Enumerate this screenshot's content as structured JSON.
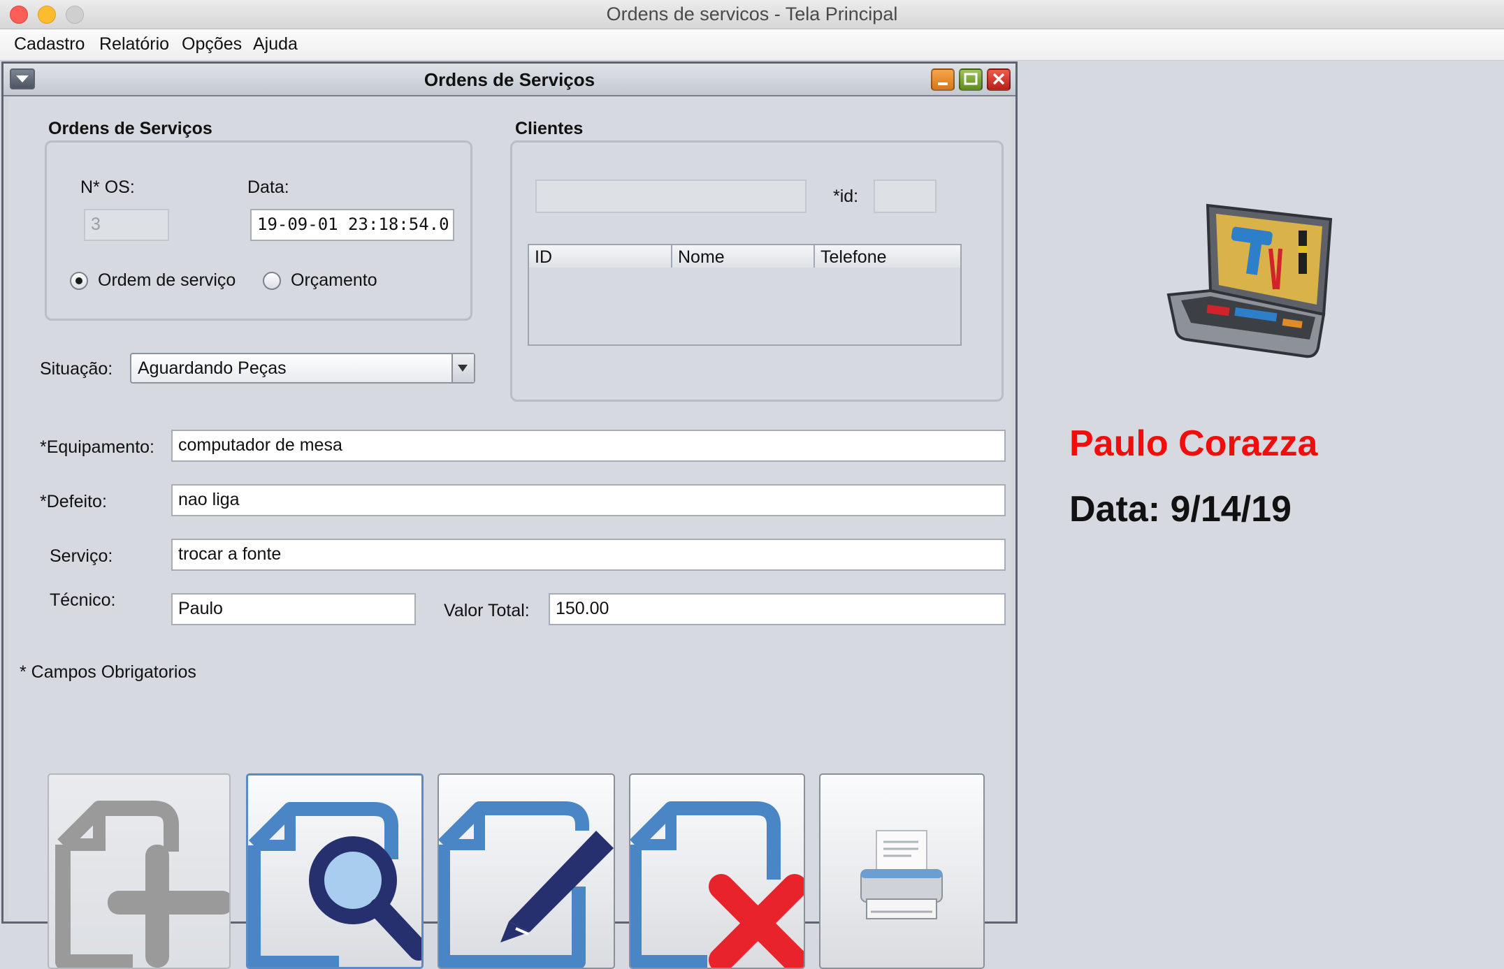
{
  "window": {
    "title": "Ordens de servicos - Tela Principal",
    "traffic_colors": {
      "close": "#fc5f57",
      "minimize": "#fdbc2e",
      "zoom": "#cfcfcf"
    }
  },
  "menubar": {
    "items": [
      {
        "label": "Cadastro"
      },
      {
        "label": "Relatório"
      },
      {
        "label": "Opções"
      },
      {
        "label": "Ajuda"
      }
    ]
  },
  "internal_frame": {
    "title": "Ordens de Serviços",
    "os_group": {
      "title": "Ordens de Serviços",
      "os_number_label": "N* OS:",
      "os_number_value": "3",
      "date_label": "Data:",
      "date_value": "19-09-01 23:18:54.0",
      "radio_os_label": "Ordem de serviço",
      "radio_orcamento_label": "Orçamento",
      "selected_type": "Ordem de serviço"
    },
    "clientes_group": {
      "title": "Clientes",
      "search_value": "",
      "id_label": "*id:",
      "id_value": "",
      "table_headers": [
        "ID",
        "Nome",
        "Telefone"
      ],
      "table_rows": []
    },
    "situacao": {
      "label": "Situação:",
      "selected": "Aguardando Peças"
    },
    "fields": {
      "equipamento_label": "*Equipamento:",
      "equipamento_value": "computador de mesa",
      "defeito_label": "*Defeito:",
      "defeito_value": "nao liga",
      "servico_label": "Serviço:",
      "servico_value": "trocar a fonte",
      "tecnico_label": "Técnico:",
      "tecnico_value": "Paulo",
      "valor_label": "Valor Total:",
      "valor_value": "150.00"
    },
    "required_note": "* Campos Obrigatorios",
    "toolbar_icons": [
      "add-document-icon",
      "search-document-icon",
      "edit-document-icon",
      "delete-document-icon",
      "printer-icon"
    ]
  },
  "side_panel": {
    "user_name": "Paulo Corazza",
    "user_name_color": "#f20d0d",
    "date_text": "Data: 9/14/19",
    "image_icon": "toolbox-icon"
  },
  "colors": {
    "icon_blue": "#4a86c5",
    "icon_navy": "#27306e",
    "icon_red": "#e8232c",
    "icon_gray": "#9a9a9a"
  }
}
